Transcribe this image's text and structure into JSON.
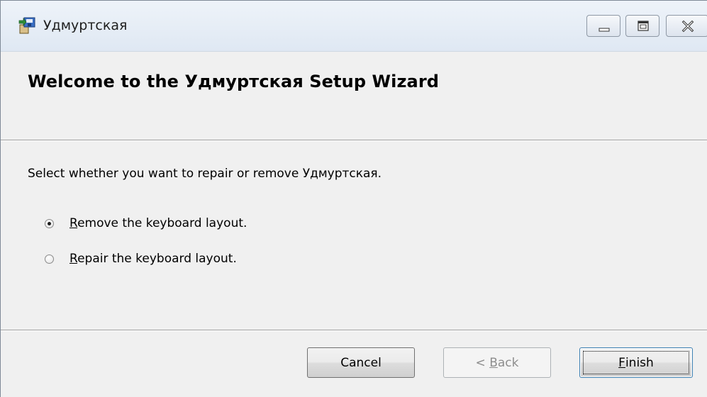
{
  "window": {
    "title": "Удмуртская",
    "icon": "installer-package-icon",
    "controls": [
      "minimize-icon",
      "maximize-icon",
      "close-icon"
    ]
  },
  "header": {
    "title": "Welcome to the Удмуртская Setup Wizard"
  },
  "body": {
    "instruction": "Select whether you want to repair or remove Удмуртская.",
    "options": [
      {
        "mnemonic": "R",
        "rest": "emove the keyboard layout.",
        "selected": true
      },
      {
        "mnemonic": "R",
        "rest": "epair the keyboard layout.",
        "selected": false
      }
    ]
  },
  "footer": {
    "cancel_label": "Cancel",
    "back_prefix": "< ",
    "back_mnemonic": "B",
    "back_rest": "ack",
    "back_enabled": false,
    "finish_mnemonic": "F",
    "finish_rest": "inish"
  }
}
